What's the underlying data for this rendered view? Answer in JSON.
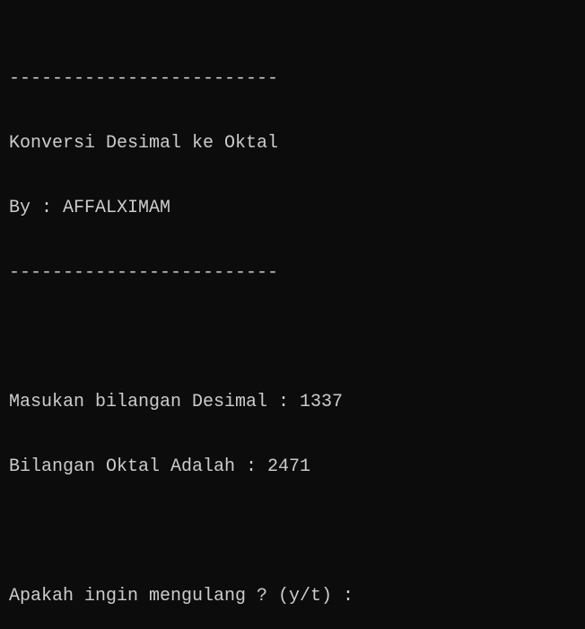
{
  "console": {
    "lines": [
      "-------------------------",
      "Konversi Desimal ke Oktal",
      "By : AFFALXIMAM",
      "-------------------------",
      "",
      "Masukan bilangan Desimal : 1337",
      "Bilangan Oktal Adalah : 2471",
      "",
      "Apakah ingin mengulang ? (y/t) : "
    ]
  }
}
